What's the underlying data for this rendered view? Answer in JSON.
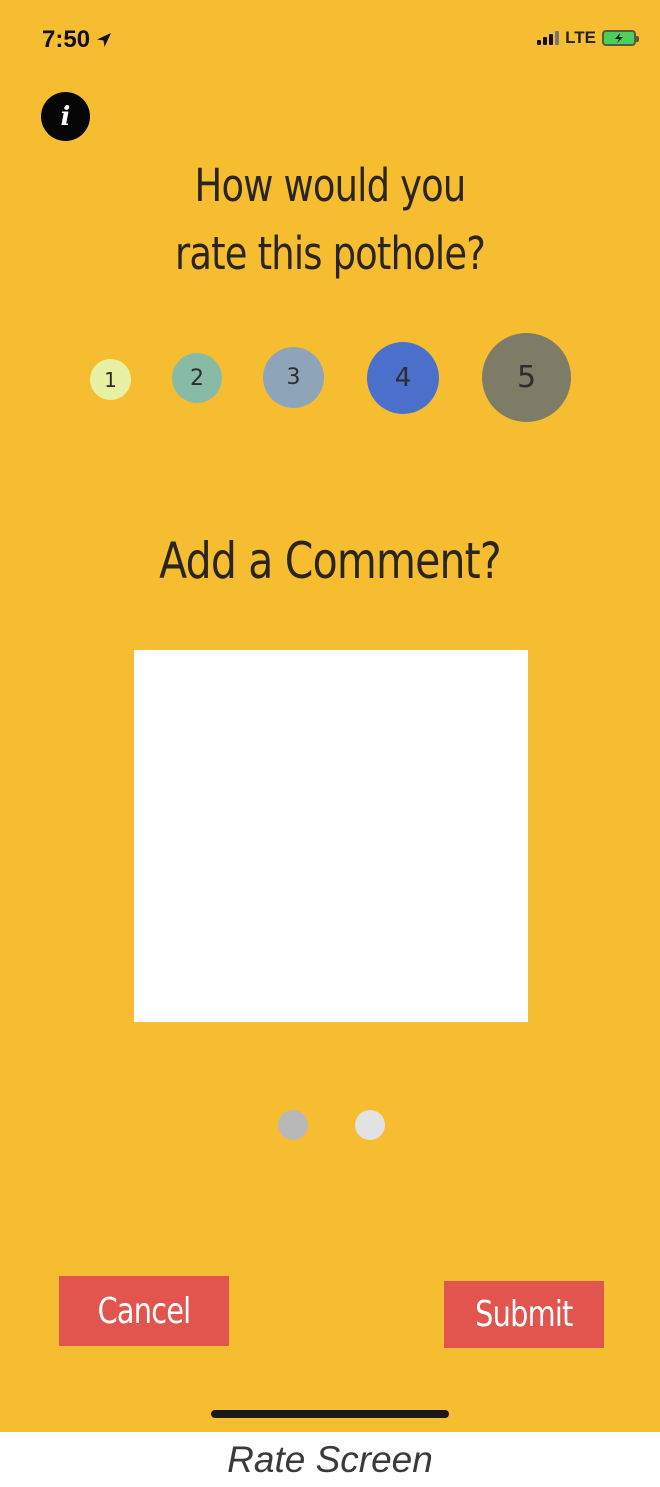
{
  "status_bar": {
    "time": "7:50",
    "location_icon": "location-arrow-icon",
    "network": "LTE",
    "signal_icon": "cellular-signal-icon",
    "battery_icon": "battery-charging-icon"
  },
  "info_button": {
    "icon": "info-icon",
    "glyph": "i"
  },
  "question": {
    "line1": "How would you",
    "line2": "rate this pothole?"
  },
  "rating": {
    "options": [
      {
        "label": "1",
        "color": "#e8f0a3"
      },
      {
        "label": "2",
        "color": "#88bba5"
      },
      {
        "label": "3",
        "color": "#8ea4b8"
      },
      {
        "label": "4",
        "color": "#4b70cc"
      },
      {
        "label": "5",
        "color": "#7e7b66"
      }
    ],
    "selected": "5"
  },
  "comment": {
    "title": "Add a Comment?",
    "value": ""
  },
  "pager": {
    "dots": [
      {
        "color": "#b8b8b8",
        "active": true
      },
      {
        "color": "#e2e2e2",
        "active": false
      }
    ]
  },
  "buttons": {
    "cancel_label": "Cancel",
    "submit_label": "Submit",
    "color": "#e2544e"
  },
  "caption": "Rate Screen",
  "theme": {
    "background": "#f7bd30"
  }
}
